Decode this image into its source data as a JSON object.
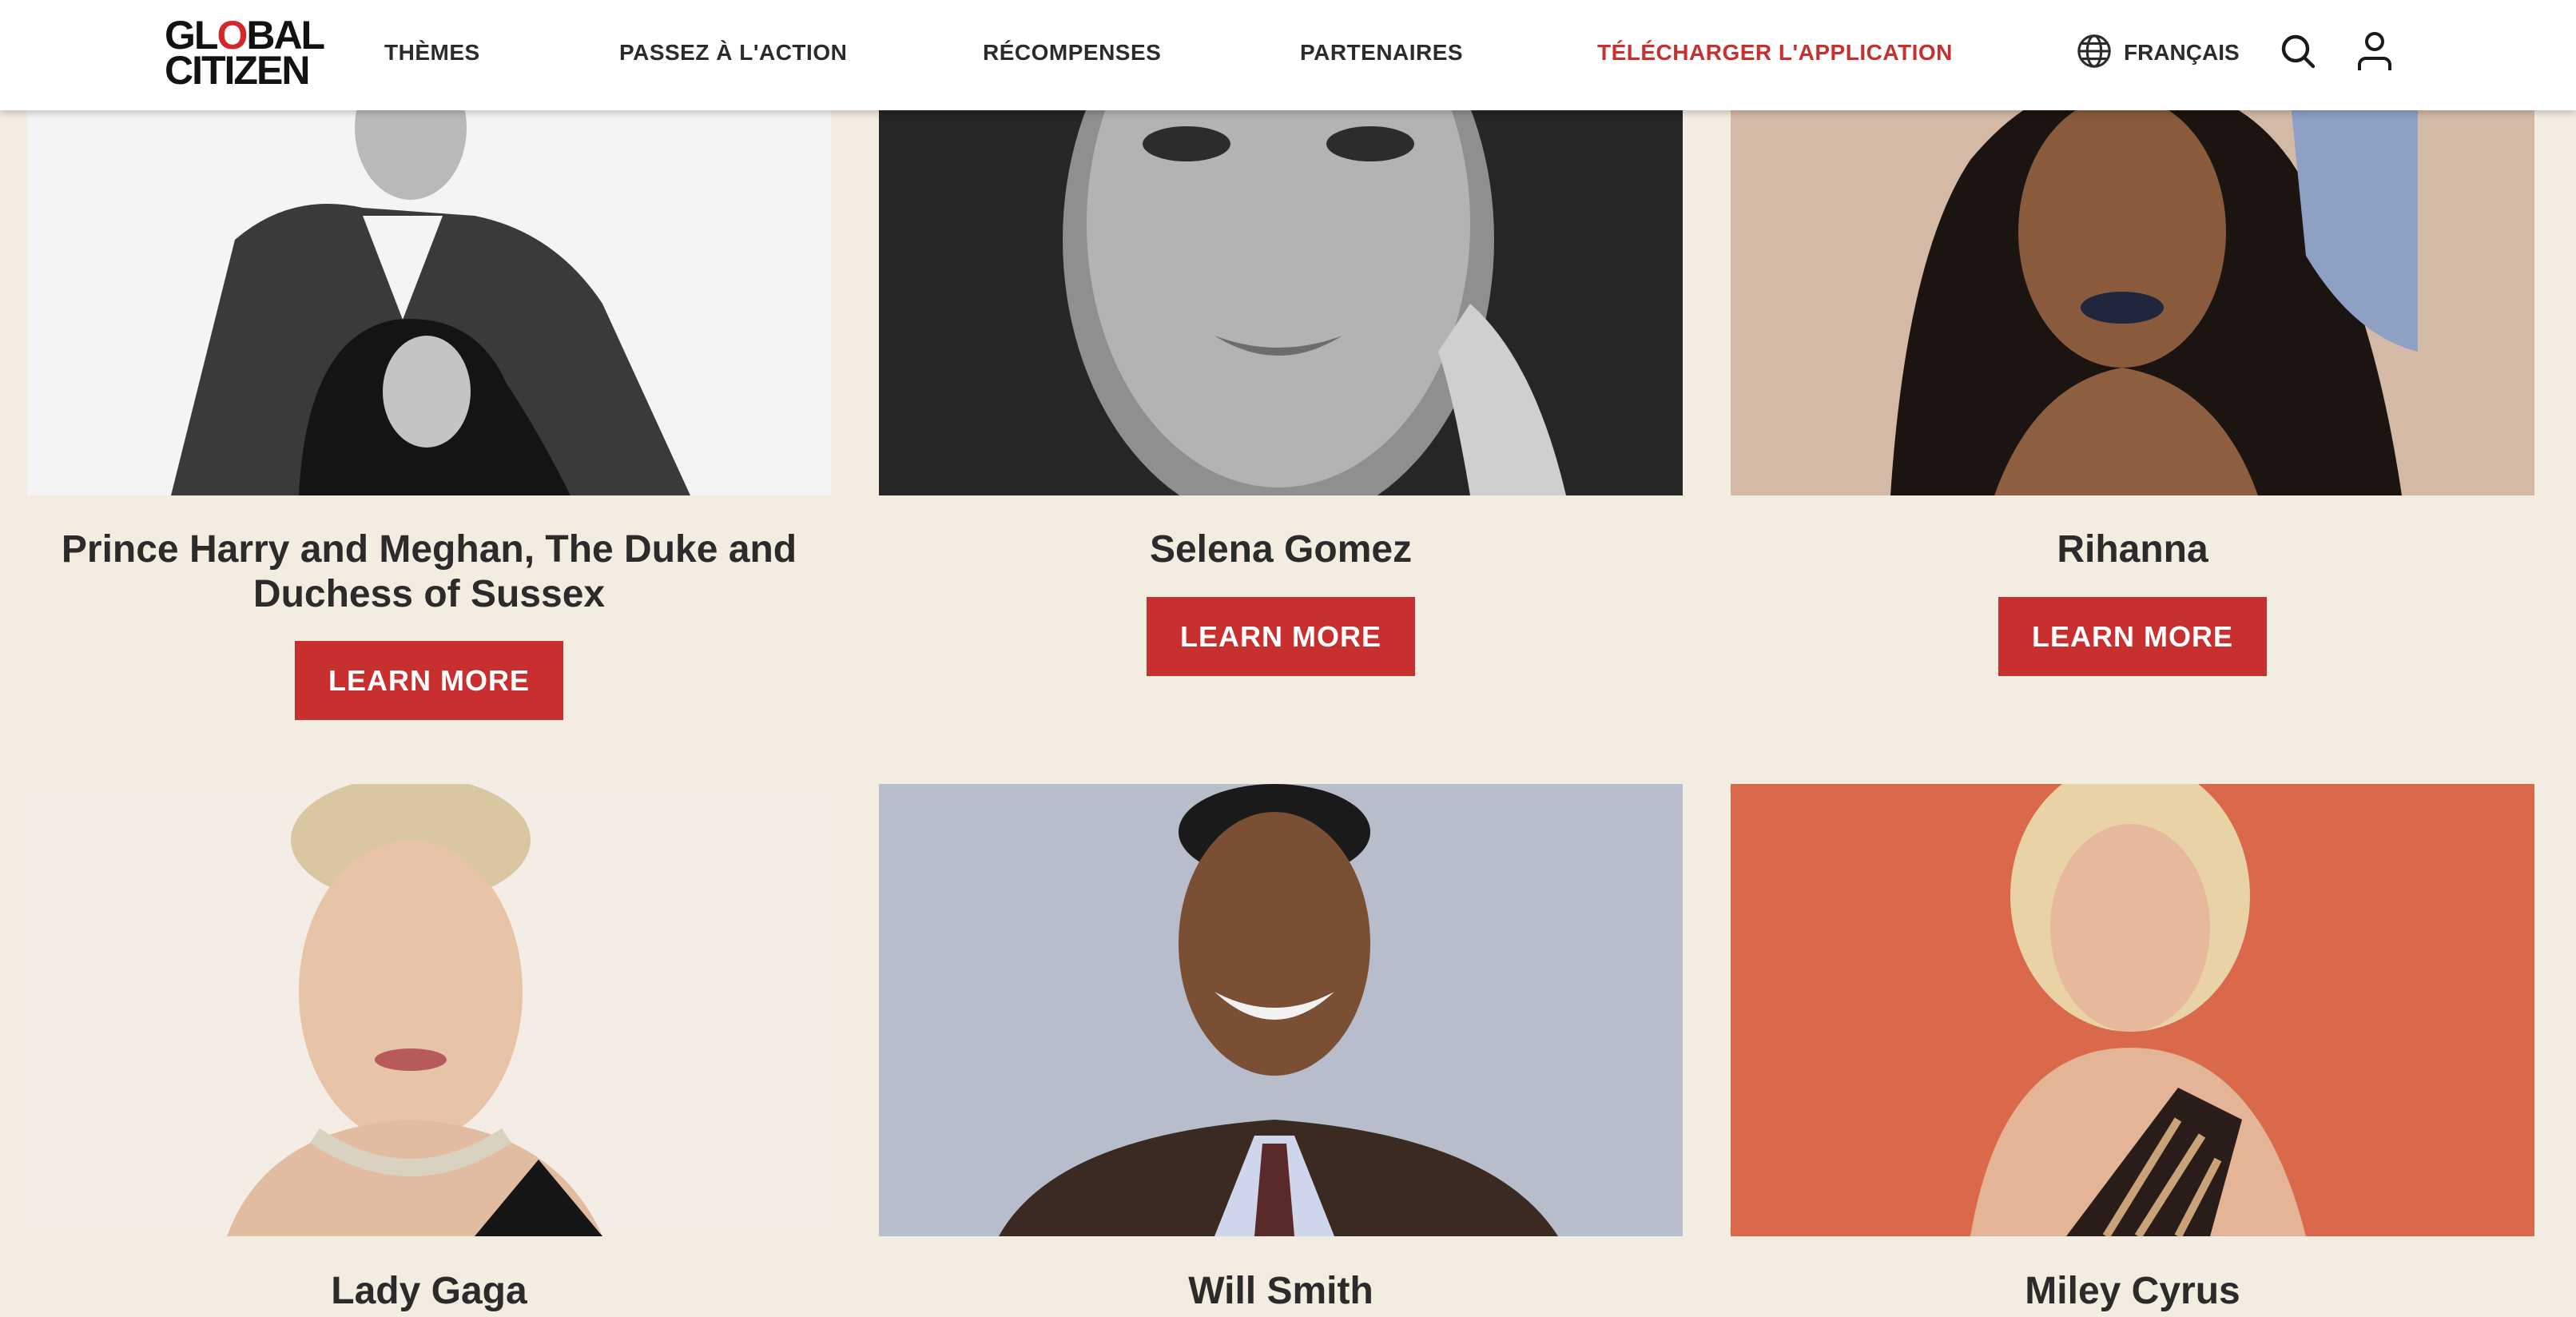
{
  "header": {
    "logo": {
      "line1_a": "GL",
      "line1_o": "O",
      "line1_b": "BAL",
      "line2": "CITIZEN"
    },
    "nav": [
      {
        "label": "THÈMES"
      },
      {
        "label": "PASSEZ À L'ACTION"
      },
      {
        "label": "RÉCOMPENSES"
      },
      {
        "label": "PARTENAIRES"
      },
      {
        "label": "TÉLÉCHARGER L'APPLICATION"
      }
    ],
    "language": {
      "label": "FRANÇAIS",
      "icon": "globe-icon"
    },
    "search_icon": "search-icon",
    "account_icon": "user-icon",
    "colors": {
      "accent": "#c8302f",
      "background": "#f3ece0",
      "text": "#2b2b2b"
    }
  },
  "cards": [
    {
      "name": "Prince Harry and Meghan, The Duke and Duchess of Sussex",
      "button": "LEARN MORE"
    },
    {
      "name": "Selena Gomez",
      "button": "LEARN MORE"
    },
    {
      "name": "Rihanna",
      "button": "LEARN MORE"
    },
    {
      "name": "Lady Gaga"
    },
    {
      "name": "Will Smith"
    },
    {
      "name": "Miley Cyrus"
    }
  ]
}
